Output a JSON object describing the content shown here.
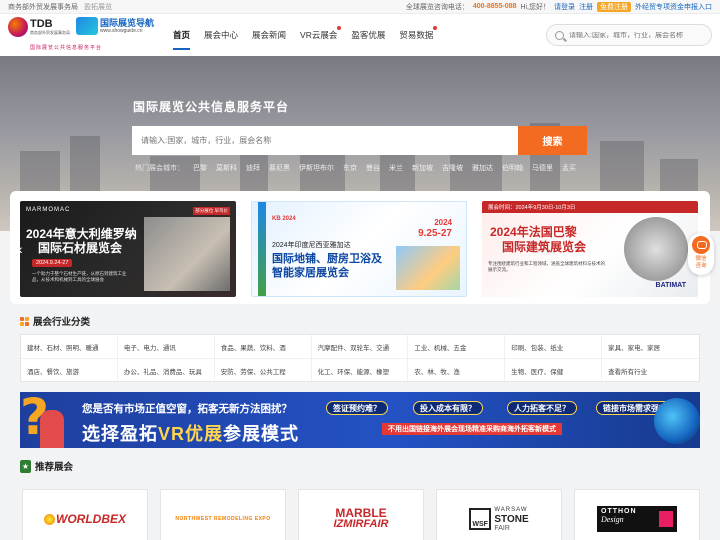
{
  "topbar": {
    "org": "商务部外贸发展事务局",
    "org_sub": "盈拓展览",
    "hotline_label": "全球展览咨询电话：",
    "hotline": "400-8855-088",
    "greeting": "Hi,您好！",
    "login": "请登录",
    "register": "注册",
    "vip": "免费注册",
    "promo": "外经贸专项资金申报入口"
  },
  "logo": {
    "tdb": "TDB",
    "tdb_sub": "商务部外贸发展事务局",
    "guide": "国际展览导航",
    "guide_url": "www.showguide.cn",
    "slogan": "国际展览公共信息服务平台"
  },
  "nav": {
    "items": [
      {
        "label": "首页",
        "active": true,
        "dot": false
      },
      {
        "label": "展会中心",
        "active": false,
        "dot": false
      },
      {
        "label": "展会新闻",
        "active": false,
        "dot": false
      },
      {
        "label": "VR云展会",
        "active": false,
        "dot": true
      },
      {
        "label": "盈客优展",
        "active": false,
        "dot": false
      },
      {
        "label": "贸易数据",
        "active": false,
        "dot": true
      }
    ]
  },
  "top_search": {
    "placeholder": "请输入:国家，城市，行业，展会名称"
  },
  "hero": {
    "title": "国际展览公共信息服务平台",
    "search_placeholder": "请输入:国家，城市，行业，展会名称",
    "search_button": "搜索",
    "hot_label": "热门展会城市：",
    "cities": [
      "巴黎",
      "莫斯科",
      "迪拜",
      "慕尼黑",
      "伊斯坦布尔",
      "东京",
      "曼谷",
      "米兰",
      "新加坡",
      "吉隆坡",
      "雅加达",
      "伯明翰",
      "马德里",
      "孟买"
    ]
  },
  "banners": [
    {
      "brand": "MARMOMAC",
      "tag": "部分展位 早鸟价",
      "title1": "2024年意大利维罗纳",
      "title2": "国际石材展览会",
      "date": "2024.9.24-27",
      "desc": "一个助力于整个石材生产链，从原石到建筑工业品，从技术和机械到工具的全球展会"
    },
    {
      "logos": "KB 2024",
      "year": "2024",
      "dates": "9.25-27",
      "sub": "2024年印度尼西亚雅加达",
      "title1": "国际地铺、厨房卫浴及",
      "title2": "智能家居展览会"
    },
    {
      "datebar": "展会时间：2024年9月30日-10月3日",
      "title1": "2024年法国巴黎",
      "title2": "国际建筑展览会",
      "desc": "专注围绕建筑行业和工程领域，涵盖全球建筑材料与技术的展示交流。",
      "brand": "BATIMAT"
    }
  ],
  "float_widget": {
    "label1": "微信",
    "label2": "咨询"
  },
  "categories": {
    "title": "展会行业分类",
    "items": [
      "建材、石材、照明、暖通",
      "电子、电力、通讯",
      "食品、果蔬、饮料、酒",
      "汽摩配件、双轮车、交通",
      "工业、机械、五金",
      "印刷、包装、纸业",
      "家具、家电、家居",
      "酒店、餐饮、旅游",
      "办公、礼品、消费品、玩具",
      "安防、劳保、公共工程",
      "化工、环保、能源、橡塑",
      "农、林、牧、渔",
      "生物、医疗、保健",
      "查看所有行业"
    ]
  },
  "promo": {
    "line1": "您是否有市场正值空窗，拓客无新方法困扰？",
    "line2_a": "选择盈拓",
    "line2_hl": "VR优展",
    "line2_b": "参展模式",
    "questions": [
      "签证预约难？",
      "投入成本有限？",
      "人力拓客不足？",
      "链接市场需求强？"
    ],
    "note": "不用出国链接海外展会现场精准采购商海外拓客新模式"
  },
  "recommended": {
    "title": "推荐展会",
    "cards": [
      {
        "logo": "WORLDBEX"
      },
      {
        "logo": "NORTHWEST REMODELING EXPO"
      },
      {
        "logo_a": "MARBLE",
        "logo_b": "IZMIRFAIR"
      },
      {
        "logo_w": "WARSAW",
        "logo_s": "STONE",
        "logo_f": "FAIR",
        "logo_wse": "WSF"
      },
      {
        "logo_a": "OTTHON",
        "logo_b": "Design"
      }
    ]
  },
  "colors": {
    "accent_orange": "#f26b21",
    "nav_blue": "#1565c0",
    "promo_blue": "#2452c4",
    "rec_green": "#2e7d32"
  }
}
